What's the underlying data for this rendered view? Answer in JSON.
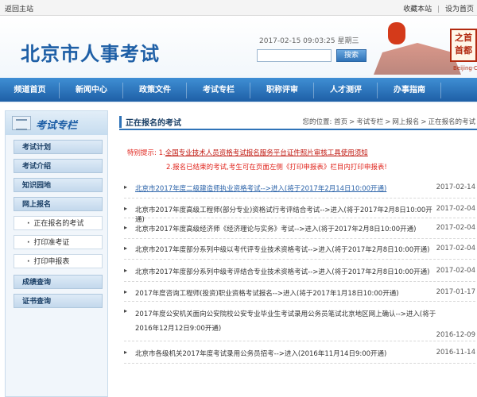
{
  "topbar": {
    "back_link": "返回主站",
    "bookmark": "收藏本站",
    "separator": "|",
    "set_home": "设为首页"
  },
  "header": {
    "site_title": "北京市人事考试",
    "datetime": "2017-02-15 09:03:25 星期三",
    "search_placeholder": "",
    "search_button": "搜索",
    "seal_text": "之首\n首都",
    "seal_caption": "Beijing·China"
  },
  "nav": {
    "items": [
      "频道首页",
      "新闻中心",
      "政策文件",
      "考试专栏",
      "职称评审",
      "人才测评",
      "办事指南"
    ]
  },
  "sidebar": {
    "title": "考试专栏",
    "items": [
      {
        "label": "考试计划",
        "type": "main"
      },
      {
        "label": "考试介绍",
        "type": "main"
      },
      {
        "label": "知识园地",
        "type": "main"
      },
      {
        "label": "网上报名",
        "type": "main"
      },
      {
        "label": "正在报名的考试",
        "type": "sub"
      },
      {
        "label": "打印准考证",
        "type": "sub"
      },
      {
        "label": "打印申报表",
        "type": "sub"
      },
      {
        "label": "成绩查询",
        "type": "main"
      },
      {
        "label": "证书查询",
        "type": "main"
      }
    ]
  },
  "main": {
    "heading": "正在报名的考试",
    "breadcrumb": {
      "prefix": "您的位置:",
      "items": [
        "首页",
        "考试专栏",
        "网上报名",
        "正在报名的考试"
      ],
      "sep": ">"
    },
    "notice": {
      "label": "特别提示:",
      "line1_prefix": "1.",
      "line1_link": "全国专业技术人员资格考试报名服务平台证件照片审核工具使用须知",
      "line2": "2.报名已结束的考试,考生可在页面左侧《打印申报表》栏目内打印申报表!"
    },
    "list": [
      {
        "text": "北京市2017年度二级建造师执业资格考试-->进入(将于2017年2月14日10:00开通)",
        "date": "2017-02-14"
      },
      {
        "text": "北京市2017年度高级工程师(部分专业)资格试行考评结合考试-->进入(将于2017年2月8日10:00开通)",
        "date": "2017-02-04"
      },
      {
        "text": "北京市2017年度高级经济师《经济理论与实务》考试-->进入(将于2017年2月8日10:00开通)",
        "date": "2017-02-04"
      },
      {
        "text": "北京市2017年度部分系列中级以考代评专业技术资格考试-->进入(将于2017年2月8日10:00开通)",
        "date": "2017-02-04"
      },
      {
        "text": "北京市2017年度部分系列中级考评结合专业技术资格考试-->进入(将于2017年2月8日10:00开通)",
        "date": "2017-02-04"
      },
      {
        "text": "2017年度咨询工程师(投资)职业资格考试报名-->进入(将于2017年1月18日10:00开通)",
        "date": "2017-01-17"
      },
      {
        "text": "2017年度公安机关面向公安院校公安专业毕业生考试录用公务员笔试北京地区网上确认-->进入(将于2016年12月12日9:00开通)",
        "date": "2016-12-09"
      },
      {
        "text": "北京市各级机关2017年度考试录用公务员招考-->进入(2016年11月14日9:00开通)",
        "date": "2016-11-14"
      }
    ]
  },
  "colors": {
    "brand_blue": "#1e5fa6",
    "alert_red": "#e0241c",
    "link_blue": "#2a62a8"
  }
}
